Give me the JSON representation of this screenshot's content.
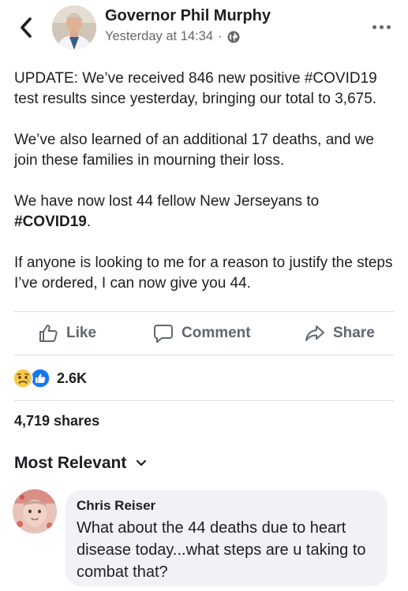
{
  "header": {
    "author": "Governor Phil Murphy",
    "timestamp": "Yesterday at 14:34",
    "separator": "·",
    "privacy_icon": "globe-icon",
    "back_icon": "chevron-left-icon",
    "more_icon": "more-horizontal-icon"
  },
  "post": {
    "paragraph1": "UPDATE: We’ve received 846 new positive #COVID19 test results since yesterday, bringing our total to 3,675.",
    "paragraph2": "We’ve also learned of an additional 17 deaths, and we join these families in mourning their loss.",
    "paragraph3_text": "We have now lost 44 fellow New Jerseyans to",
    "paragraph3_hashtag": "#COVID19",
    "paragraph3_end": ".",
    "paragraph4": "If anyone is looking to me for a reason to justify the steps I’ve ordered, I can now give you 44."
  },
  "actions": {
    "like_label": "Like",
    "comment_label": "Comment",
    "share_label": "Share"
  },
  "reactions": {
    "icons": [
      "sad-reaction-icon",
      "like-reaction-icon"
    ],
    "count": "2.6K"
  },
  "shares": "4,719 shares",
  "comments_sort": {
    "label": "Most Relevant",
    "icon": "chevron-down-icon"
  },
  "comments": [
    {
      "author": "Chris Reiser",
      "text": "What about the 44 deaths due to heart disease today...what steps are u taking to combat that?"
    }
  ],
  "colors": {
    "text_primary": "#1c1e21",
    "text_secondary": "#65676b",
    "facebook_blue": "#1877f2",
    "divider": "#dadde1",
    "comment_bg": "#f0f2f5"
  }
}
